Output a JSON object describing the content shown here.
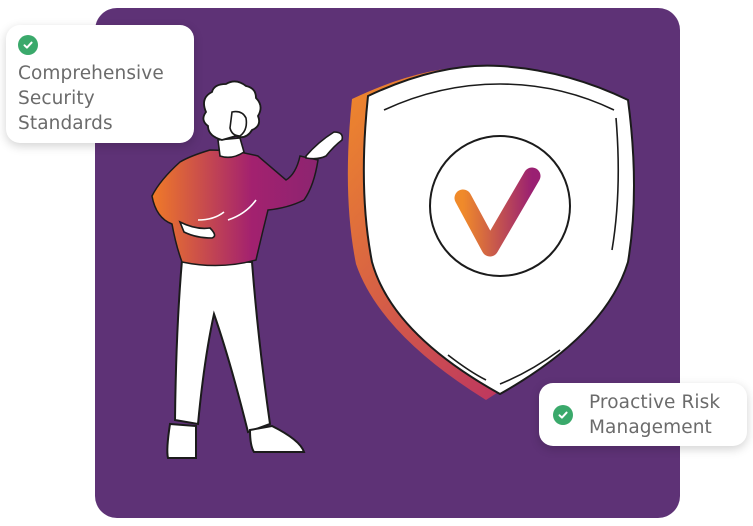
{
  "cards": [
    {
      "text": "Comprehensive Security Standards",
      "icon": "check-circle-icon"
    },
    {
      "text": "Proactive Risk Management",
      "icon": "check-circle-icon"
    }
  ],
  "colors": {
    "panel": "#5e3276",
    "check": "#3aa96b",
    "accent_orange": "#f07a28",
    "accent_magenta": "#a3216f"
  }
}
